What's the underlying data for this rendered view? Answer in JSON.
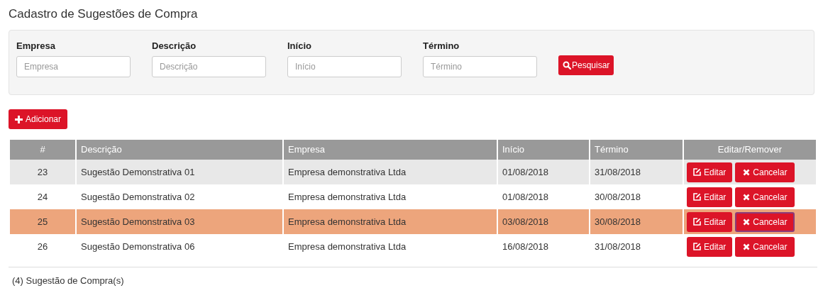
{
  "title": "Cadastro de Sugestões de Compra",
  "filters": [
    {
      "label": "Empresa",
      "placeholder": "Empresa"
    },
    {
      "label": "Descrição",
      "placeholder": "Descrição"
    },
    {
      "label": "Início",
      "placeholder": "Início"
    },
    {
      "label": "Término",
      "placeholder": "Término"
    }
  ],
  "search_button": "Pesquisar",
  "add_button": "Adicionar",
  "table": {
    "columns": [
      "#",
      "Descrição",
      "Empresa",
      "Início",
      "Término",
      "Editar/Remover"
    ],
    "rows": [
      {
        "id": "23",
        "descricao": "Sugestão Demonstrativa 01",
        "empresa": "Empresa demonstrativa Ltda",
        "inicio": "01/08/2018",
        "termino": "31/08/2018",
        "edit": "Editar",
        "cancel": "Cancelar",
        "selected": false,
        "cancel_focused": false
      },
      {
        "id": "24",
        "descricao": "Sugestão Demonstrativa 02",
        "empresa": "Empresa demonstrativa Ltda",
        "inicio": "01/08/2018",
        "termino": "30/08/2018",
        "edit": "Editar",
        "cancel": "Cancelar",
        "selected": false,
        "cancel_focused": false
      },
      {
        "id": "25",
        "descricao": "Sugestão Demonstrativa 03",
        "empresa": "Empresa demonstrativa Ltda",
        "inicio": "03/08/2018",
        "termino": "30/08/2018",
        "edit": "Editar",
        "cancel": "Cancelar",
        "selected": true,
        "cancel_focused": true
      },
      {
        "id": "26",
        "descricao": "Sugestão Demonstrativa 06",
        "empresa": "Empresa demonstrativa Ltda",
        "inicio": "16/08/2018",
        "termino": "31/08/2018",
        "edit": "Editar",
        "cancel": "Cancelar",
        "selected": false,
        "cancel_focused": false
      }
    ]
  },
  "footer": "(4) Sugestão de Compra(s)"
}
